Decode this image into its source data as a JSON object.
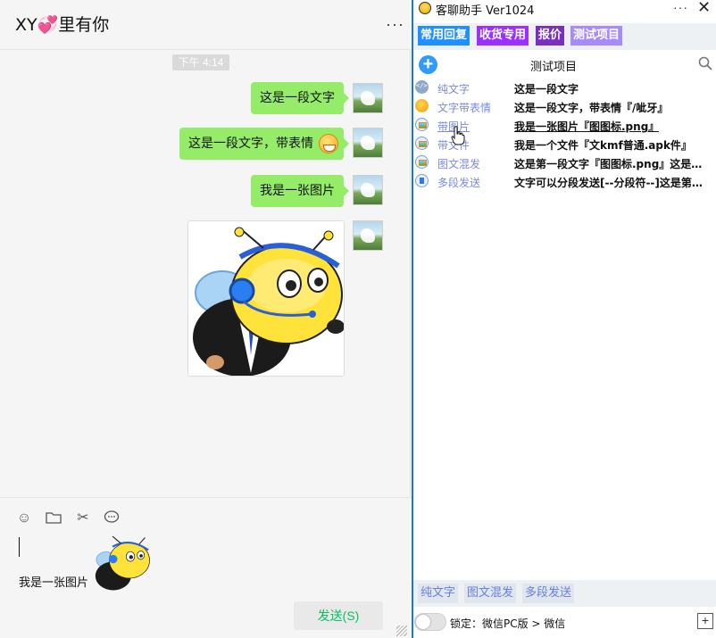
{
  "chat": {
    "title": "XY💞里有你",
    "more": "···",
    "time": "下午 4:14",
    "messages": [
      {
        "text": "这是一段文字"
      },
      {
        "text": "这是一段文字，带表情"
      },
      {
        "text": "我是一张图片"
      }
    ],
    "draft_text": "我是一张图片",
    "send_label": "发送(S)"
  },
  "panel": {
    "title": "客聊助手 Ver1024",
    "more": "···",
    "close": "✕",
    "tabs": [
      {
        "label": "常用回复",
        "color": "#1e90ff"
      },
      {
        "label": "收货专用",
        "color": "#9b30ff"
      },
      {
        "label": "报价",
        "color": "#7b2fbe"
      },
      {
        "label": "测试项目",
        "color": "#a78bfa"
      }
    ],
    "add_label": "+",
    "list_title": "测试项目",
    "rows": [
      {
        "name": "纯文字",
        "content": "这是一段文字",
        "icon": "code-icon"
      },
      {
        "name": "文字带表情",
        "content": "这是一段文字，带表情『/呲牙』",
        "icon": "emoji-icon"
      },
      {
        "name": "带图片",
        "content": "我是一张图片『图图标.png』",
        "icon": "image-icon"
      },
      {
        "name": "带文件",
        "content": "我是一个文件『文kmf普通.apk件』",
        "icon": "image-icon"
      },
      {
        "name": "图文混发",
        "content": "这是第一段文字『图图标.png』这是第二段文字",
        "icon": "image-icon"
      },
      {
        "name": "多段发送",
        "content": "文字可以分段发送[--分段符--]这是第二段文字",
        "icon": "file-icon"
      }
    ],
    "bottom_tags": [
      "纯文字",
      "图文混发",
      "多段发送"
    ],
    "lock_label": "锁定：微信PC版 > 微信",
    "corner_label": "+"
  },
  "colors": {
    "bubble": "#95ec69",
    "send": "#07c160",
    "accent": "#1a73e8"
  }
}
